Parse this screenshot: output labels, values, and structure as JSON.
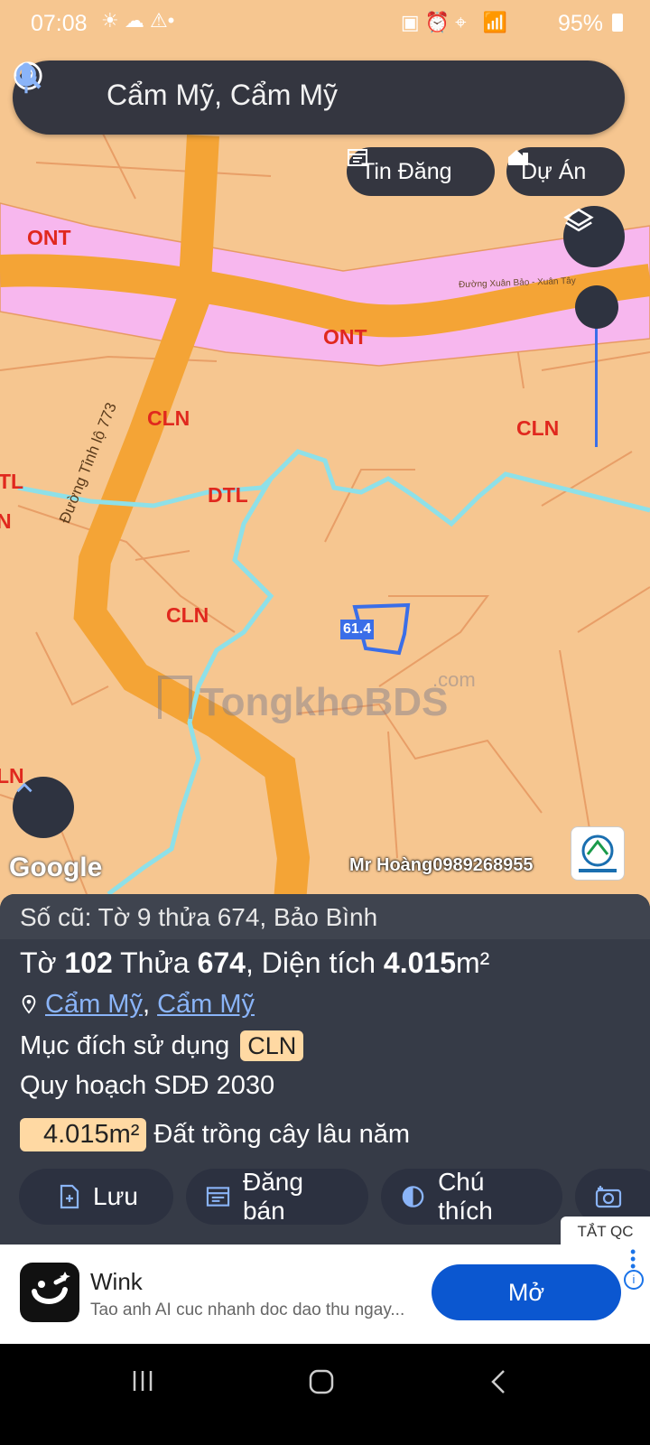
{
  "status_bar": {
    "time": "07:08",
    "battery": "95%",
    "left_icons": [
      "sun-icon",
      "cloud-icon",
      "warning-icon",
      "can-badge"
    ],
    "right_icons": [
      "sim-icon",
      "alarm-icon",
      "location-icon",
      "wifi-icon",
      "volte-icon",
      "signal-icon"
    ]
  },
  "search": {
    "query": "Cẩm Mỹ, Cẩm Mỹ"
  },
  "chips": {
    "listings": "Tin Đăng",
    "projects": "Dự Án"
  },
  "map": {
    "zone_labels": [
      "ONT",
      "ONT",
      "CLN",
      "CLN",
      "DTL",
      "CLN",
      "TL",
      "N",
      "LN"
    ],
    "road_label_1": "Đường Xuân Bảo - Xuân Tây",
    "road_label_2": "Đường Tỉnh lộ 773",
    "parcel_label": "61.4",
    "watermark": "TongkhoBDS",
    "watermark_suffix": ".com",
    "google_label": "Google",
    "agent_text": "Mr Hoàng0989268955",
    "colors": {
      "land": "#f6c690",
      "residential": "#f7b7ee",
      "road": "#f4a436",
      "river": "#8ee0e8",
      "parcel": "#3a6ee8"
    }
  },
  "panel": {
    "old_info": "Số cũ: Tờ 9 thửa 674, Bảo Bình",
    "sheet_label": "Tờ",
    "sheet_no": "102",
    "parcel_label": "Thửa",
    "parcel_no": "674",
    "area_label": ", Diện tích",
    "area_value": "4.015",
    "area_unit": "m²",
    "location_1": "Cẩm Mỹ",
    "location_sep": ",",
    "location_2": "Cẩm Mỹ",
    "purpose_label": "Mục đích sử dụng",
    "purpose_code": "CLN",
    "plan_label": "Quy hoạch SDĐ 2030",
    "plan_area": "4.015m²",
    "plan_type": "Đất trồng cây lâu năm",
    "buttons": {
      "save": "Lưu",
      "post_sale": "Đăng bán",
      "legend": "Chú thích"
    }
  },
  "ad": {
    "close_ads": "TẮT QC",
    "app_name": "Wink",
    "subtitle": "Tao anh AI cuc nhanh doc dao thu ngay...",
    "open_label": "Mở"
  }
}
